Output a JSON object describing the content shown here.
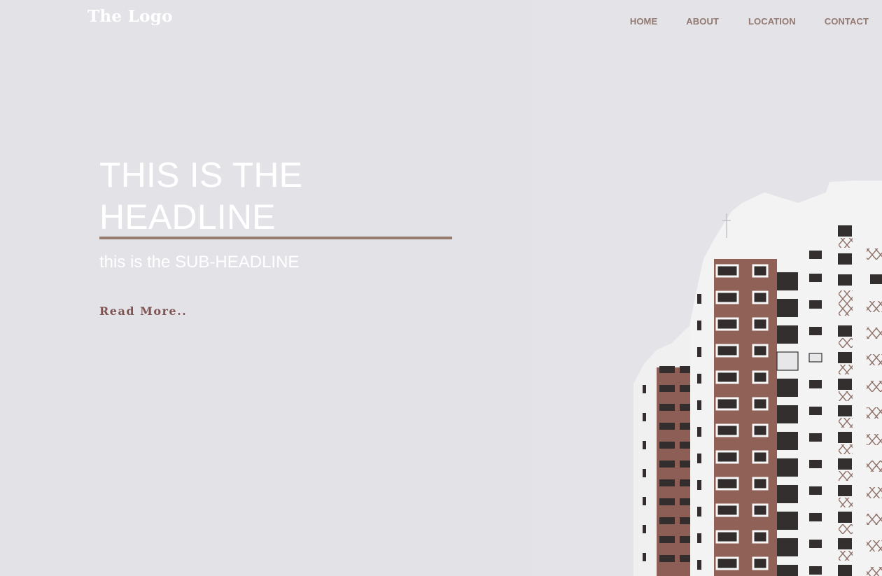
{
  "header": {
    "logo_text": "The Logo",
    "nav": [
      {
        "label": "HOME"
      },
      {
        "label": "ABOUT"
      },
      {
        "label": "LOCATION"
      },
      {
        "label": "CONTACT"
      }
    ]
  },
  "hero": {
    "headline_line1": "THIS IS THE",
    "headline_line2": "HEADLINE",
    "subheadline": "this is the SUB-HEADLINE",
    "cta_label": "Read More.."
  },
  "colors": {
    "background": "#e3e2e7",
    "accent": "#957a70",
    "cta": "#7f5554",
    "nav_text": "#8e746c",
    "building_white": "#f2f2f3",
    "building_brown": "#8b5a4f"
  }
}
